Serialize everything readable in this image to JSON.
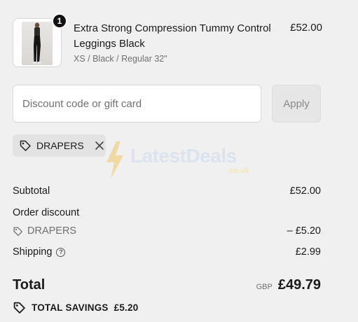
{
  "product": {
    "quantity": "1",
    "name": "Extra Strong Compression Tummy Control Leggings Black",
    "variant": "XS / Black / Regular 32\"",
    "price": "£52.00",
    "image_icon": "leggings-product-photo"
  },
  "discount": {
    "placeholder": "Discount code or gift card",
    "value": "",
    "apply_label": "Apply"
  },
  "applied_code": {
    "code": "DRAPERS",
    "tag_icon": "tag-icon",
    "remove_icon": "close-icon"
  },
  "watermark": {
    "brand": "LatestDeals",
    "suffix": ".co.uk"
  },
  "summary": {
    "subtotal_label": "Subtotal",
    "subtotal_value": "£52.00",
    "order_discount_label": "Order discount",
    "discount_code": "DRAPERS",
    "discount_value": "– £5.20",
    "shipping_label": "Shipping",
    "shipping_value": "£2.99"
  },
  "total": {
    "label": "Total",
    "currency": "GBP",
    "amount": "£49.79"
  },
  "savings": {
    "label": "TOTAL SAVINGS",
    "amount": "£5.20"
  },
  "colors": {
    "background": "#f0f0f0",
    "text": "#1a1a1a",
    "muted": "#707070",
    "badge": "#111111"
  }
}
